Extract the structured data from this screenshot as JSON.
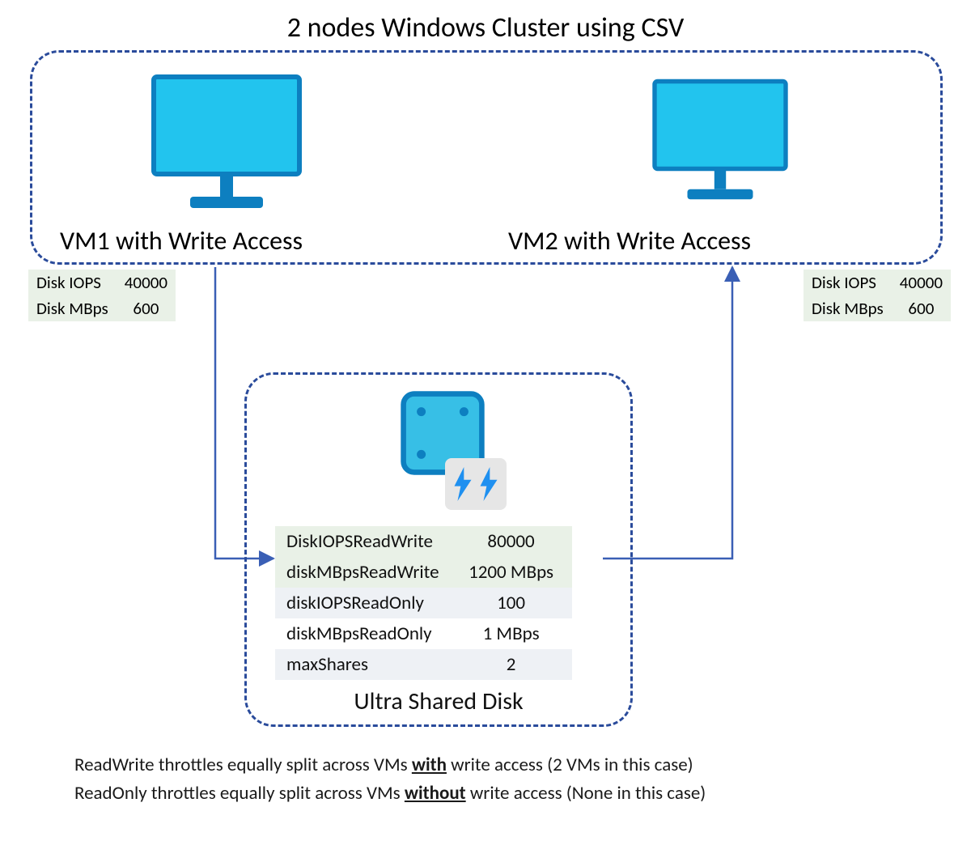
{
  "title": "2 nodes Windows Cluster using CSV",
  "vm1": {
    "label": "VM1 with Write Access",
    "iops_label": "Disk IOPS",
    "iops_value": "40000",
    "mbps_label": "Disk MBps",
    "mbps_value": "600"
  },
  "vm2": {
    "label": "VM2 with Write Access",
    "iops_label": "Disk IOPS",
    "iops_value": "40000",
    "mbps_label": "Disk MBps",
    "mbps_value": "600"
  },
  "disk": {
    "title": "Ultra Shared Disk",
    "rows": [
      {
        "label": "DiskIOPSReadWrite",
        "value": "80000"
      },
      {
        "label": "diskMBpsReadWrite",
        "value": "1200 MBps"
      },
      {
        "label": "diskIOPSReadOnly",
        "value": "100"
      },
      {
        "label": "diskMBpsReadOnly",
        "value": "1 MBps"
      },
      {
        "label": "maxShares",
        "value": "2"
      }
    ]
  },
  "notes": {
    "line1_pre": "ReadWrite throttles equally split across VMs ",
    "line1_em": "with",
    "line1_post": " write access (2 VMs in this case)",
    "line2_pre": "ReadOnly throttles equally split across VMs ",
    "line2_em": "without",
    "line2_post": " write access (None in this case)"
  },
  "colors": {
    "dashed_border": "#2a4b9b",
    "arrow": "#3a5fb5",
    "monitor_fill": "#22c4ee",
    "monitor_stroke": "#0d7fc0",
    "disk_fill": "#37bfe6",
    "disk_stroke": "#0d7fc0",
    "bolt": "#1f90f0"
  }
}
